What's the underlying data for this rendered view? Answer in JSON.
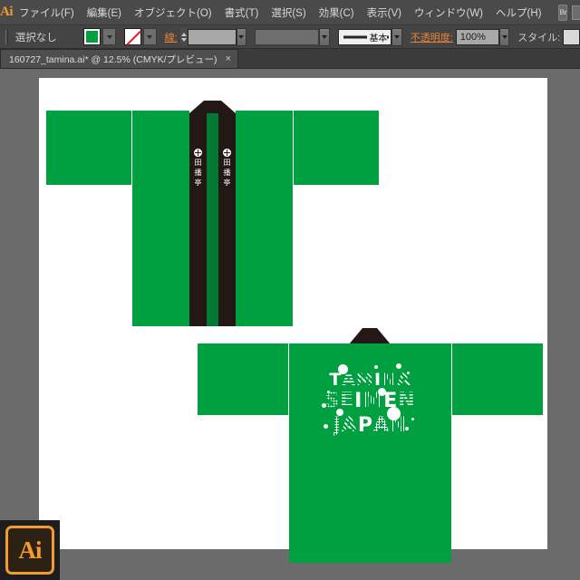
{
  "app": {
    "name": "Ai",
    "logo_label": "Ai",
    "splash_label": "Ai"
  },
  "menubar": {
    "items": [
      {
        "label": "ファイル(F)",
        "name": "menu-file"
      },
      {
        "label": "編集(E)",
        "name": "menu-edit"
      },
      {
        "label": "オブジェクト(O)",
        "name": "menu-object"
      },
      {
        "label": "書式(T)",
        "name": "menu-type"
      },
      {
        "label": "選択(S)",
        "name": "menu-select"
      },
      {
        "label": "効果(C)",
        "name": "menu-effect"
      },
      {
        "label": "表示(V)",
        "name": "menu-view"
      },
      {
        "label": "ウィンドウ(W)",
        "name": "menu-window"
      },
      {
        "label": "ヘルプ(H)",
        "name": "menu-help"
      }
    ],
    "bridge_button": "Br",
    "workspace_switcher": "workspace-switcher-icon"
  },
  "controlbar": {
    "selection_status": "選択なし",
    "fill_swatch_color": "#00a040",
    "stroke_swatch": "none",
    "stroke_label": "線:",
    "stroke_weight_value": "",
    "stroke_style_value": "",
    "stroke_profile_label": "基本",
    "opacity_label": "不透明度:",
    "opacity_value": "100%",
    "style_label": "スタイル:"
  },
  "document_tab": {
    "title": "160727_tamina.ai* @ 12.5% (CMYK/プレビュー)",
    "close_glyph": "×"
  },
  "artwork": {
    "colors": {
      "green": "#00a040",
      "green_dark": "#007a33",
      "collar_dark": "#231815",
      "white": "#ffffff",
      "artboard": "#ffffff",
      "canvas": "#6b6b6b"
    },
    "front_garment": {
      "name": "happi-coat-front",
      "collar_symbols_left": [
        "crest",
        "田",
        "播",
        "亭"
      ],
      "collar_symbols_right": [
        "crest",
        "田",
        "播",
        "亭"
      ]
    },
    "back_garment": {
      "name": "happi-coat-back",
      "print": {
        "line1": [
          "T",
          "A",
          "M",
          "I",
          "N",
          "A"
        ],
        "line2": [
          "S",
          "E",
          "I",
          "M",
          "E",
          "N"
        ],
        "line3": [
          "J",
          "A",
          "P",
          "A",
          "N"
        ]
      }
    }
  }
}
